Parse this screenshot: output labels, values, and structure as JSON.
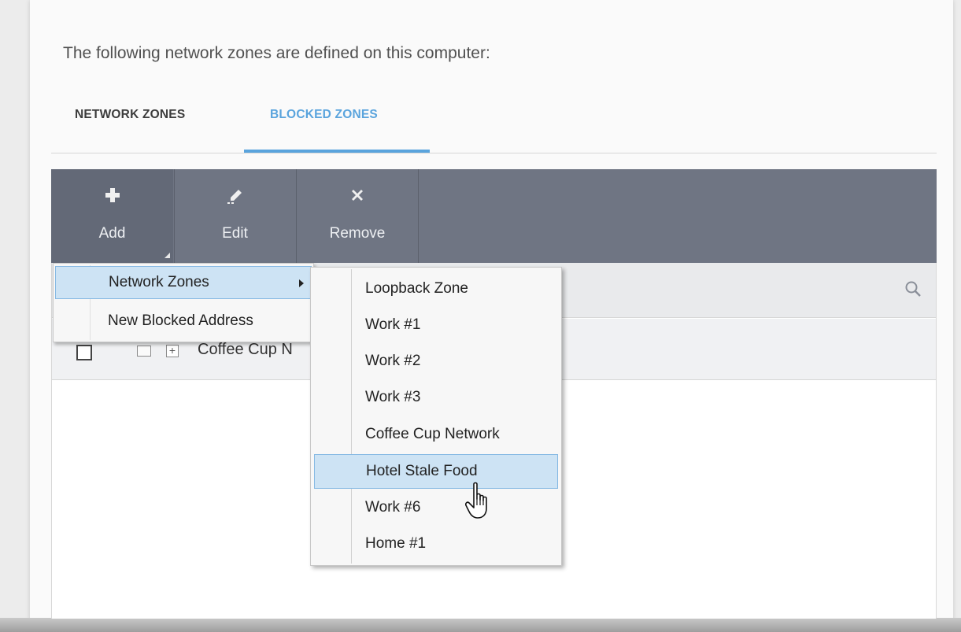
{
  "header": {
    "text": "The following network zones are defined on this computer:"
  },
  "tabs": [
    {
      "label": "NETWORK ZONES",
      "active": false
    },
    {
      "label": "BLOCKED ZONES",
      "active": true
    }
  ],
  "accent_color": "#5aa4dd",
  "toolbar": {
    "buttons": [
      {
        "label": "Add",
        "icon": "plus-icon",
        "has_dropdown": true
      },
      {
        "label": "Edit",
        "icon": "pencil-icon"
      },
      {
        "label": "Remove",
        "icon": "x-icon"
      }
    ]
  },
  "search": {
    "icon": "search-icon"
  },
  "rows": [
    {
      "name": "Coffee Cup N",
      "checked": false
    }
  ],
  "add_menu": {
    "items": [
      {
        "label": "Network Zones",
        "has_submenu": true,
        "highlighted": true
      },
      {
        "label": "New Blocked Address",
        "has_submenu": false,
        "highlighted": false
      }
    ]
  },
  "network_zones_submenu": {
    "items": [
      {
        "label": "Loopback Zone"
      },
      {
        "label": "Work #1"
      },
      {
        "label": "Work #2"
      },
      {
        "label": "Work #3"
      },
      {
        "label": "Coffee Cup Network"
      },
      {
        "label": "Hotel Stale Food",
        "highlighted": true
      },
      {
        "label": "Work #6"
      },
      {
        "label": "Home #1"
      }
    ]
  },
  "cursor": "hand-pointer-icon"
}
